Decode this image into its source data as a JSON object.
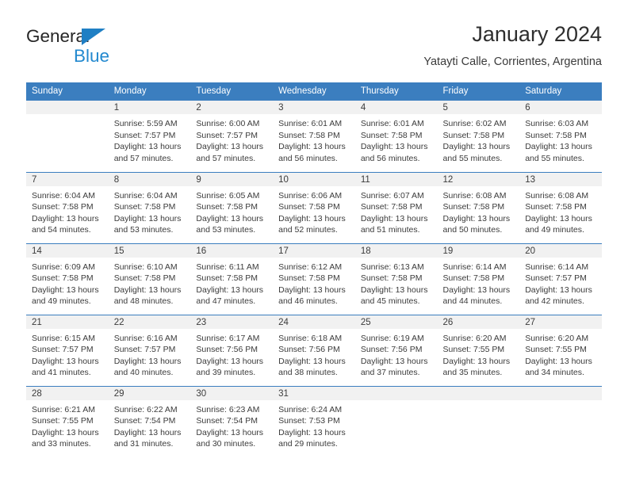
{
  "brand": {
    "name_top": "General",
    "name_bottom": "Blue",
    "color_dark": "#262626",
    "color_blue": "#2389cf"
  },
  "header": {
    "title": "January 2024",
    "subtitle": "Yatayti Calle, Corrientes, Argentina"
  },
  "theme": {
    "header_blue": "#3b7ebf",
    "daynum_band": "#f1f1f1",
    "text": "#3b3b3b"
  },
  "weekdays": [
    "Sunday",
    "Monday",
    "Tuesday",
    "Wednesday",
    "Thursday",
    "Friday",
    "Saturday"
  ],
  "weeks": [
    [
      {
        "day": "",
        "lines": []
      },
      {
        "day": "1",
        "lines": [
          "Sunrise: 5:59 AM",
          "Sunset: 7:57 PM",
          "Daylight: 13 hours",
          "and 57 minutes."
        ]
      },
      {
        "day": "2",
        "lines": [
          "Sunrise: 6:00 AM",
          "Sunset: 7:57 PM",
          "Daylight: 13 hours",
          "and 57 minutes."
        ]
      },
      {
        "day": "3",
        "lines": [
          "Sunrise: 6:01 AM",
          "Sunset: 7:58 PM",
          "Daylight: 13 hours",
          "and 56 minutes."
        ]
      },
      {
        "day": "4",
        "lines": [
          "Sunrise: 6:01 AM",
          "Sunset: 7:58 PM",
          "Daylight: 13 hours",
          "and 56 minutes."
        ]
      },
      {
        "day": "5",
        "lines": [
          "Sunrise: 6:02 AM",
          "Sunset: 7:58 PM",
          "Daylight: 13 hours",
          "and 55 minutes."
        ]
      },
      {
        "day": "6",
        "lines": [
          "Sunrise: 6:03 AM",
          "Sunset: 7:58 PM",
          "Daylight: 13 hours",
          "and 55 minutes."
        ]
      }
    ],
    [
      {
        "day": "7",
        "lines": [
          "Sunrise: 6:04 AM",
          "Sunset: 7:58 PM",
          "Daylight: 13 hours",
          "and 54 minutes."
        ]
      },
      {
        "day": "8",
        "lines": [
          "Sunrise: 6:04 AM",
          "Sunset: 7:58 PM",
          "Daylight: 13 hours",
          "and 53 minutes."
        ]
      },
      {
        "day": "9",
        "lines": [
          "Sunrise: 6:05 AM",
          "Sunset: 7:58 PM",
          "Daylight: 13 hours",
          "and 53 minutes."
        ]
      },
      {
        "day": "10",
        "lines": [
          "Sunrise: 6:06 AM",
          "Sunset: 7:58 PM",
          "Daylight: 13 hours",
          "and 52 minutes."
        ]
      },
      {
        "day": "11",
        "lines": [
          "Sunrise: 6:07 AM",
          "Sunset: 7:58 PM",
          "Daylight: 13 hours",
          "and 51 minutes."
        ]
      },
      {
        "day": "12",
        "lines": [
          "Sunrise: 6:08 AM",
          "Sunset: 7:58 PM",
          "Daylight: 13 hours",
          "and 50 minutes."
        ]
      },
      {
        "day": "13",
        "lines": [
          "Sunrise: 6:08 AM",
          "Sunset: 7:58 PM",
          "Daylight: 13 hours",
          "and 49 minutes."
        ]
      }
    ],
    [
      {
        "day": "14",
        "lines": [
          "Sunrise: 6:09 AM",
          "Sunset: 7:58 PM",
          "Daylight: 13 hours",
          "and 49 minutes."
        ]
      },
      {
        "day": "15",
        "lines": [
          "Sunrise: 6:10 AM",
          "Sunset: 7:58 PM",
          "Daylight: 13 hours",
          "and 48 minutes."
        ]
      },
      {
        "day": "16",
        "lines": [
          "Sunrise: 6:11 AM",
          "Sunset: 7:58 PM",
          "Daylight: 13 hours",
          "and 47 minutes."
        ]
      },
      {
        "day": "17",
        "lines": [
          "Sunrise: 6:12 AM",
          "Sunset: 7:58 PM",
          "Daylight: 13 hours",
          "and 46 minutes."
        ]
      },
      {
        "day": "18",
        "lines": [
          "Sunrise: 6:13 AM",
          "Sunset: 7:58 PM",
          "Daylight: 13 hours",
          "and 45 minutes."
        ]
      },
      {
        "day": "19",
        "lines": [
          "Sunrise: 6:14 AM",
          "Sunset: 7:58 PM",
          "Daylight: 13 hours",
          "and 44 minutes."
        ]
      },
      {
        "day": "20",
        "lines": [
          "Sunrise: 6:14 AM",
          "Sunset: 7:57 PM",
          "Daylight: 13 hours",
          "and 42 minutes."
        ]
      }
    ],
    [
      {
        "day": "21",
        "lines": [
          "Sunrise: 6:15 AM",
          "Sunset: 7:57 PM",
          "Daylight: 13 hours",
          "and 41 minutes."
        ]
      },
      {
        "day": "22",
        "lines": [
          "Sunrise: 6:16 AM",
          "Sunset: 7:57 PM",
          "Daylight: 13 hours",
          "and 40 minutes."
        ]
      },
      {
        "day": "23",
        "lines": [
          "Sunrise: 6:17 AM",
          "Sunset: 7:56 PM",
          "Daylight: 13 hours",
          "and 39 minutes."
        ]
      },
      {
        "day": "24",
        "lines": [
          "Sunrise: 6:18 AM",
          "Sunset: 7:56 PM",
          "Daylight: 13 hours",
          "and 38 minutes."
        ]
      },
      {
        "day": "25",
        "lines": [
          "Sunrise: 6:19 AM",
          "Sunset: 7:56 PM",
          "Daylight: 13 hours",
          "and 37 minutes."
        ]
      },
      {
        "day": "26",
        "lines": [
          "Sunrise: 6:20 AM",
          "Sunset: 7:55 PM",
          "Daylight: 13 hours",
          "and 35 minutes."
        ]
      },
      {
        "day": "27",
        "lines": [
          "Sunrise: 6:20 AM",
          "Sunset: 7:55 PM",
          "Daylight: 13 hours",
          "and 34 minutes."
        ]
      }
    ],
    [
      {
        "day": "28",
        "lines": [
          "Sunrise: 6:21 AM",
          "Sunset: 7:55 PM",
          "Daylight: 13 hours",
          "and 33 minutes."
        ]
      },
      {
        "day": "29",
        "lines": [
          "Sunrise: 6:22 AM",
          "Sunset: 7:54 PM",
          "Daylight: 13 hours",
          "and 31 minutes."
        ]
      },
      {
        "day": "30",
        "lines": [
          "Sunrise: 6:23 AM",
          "Sunset: 7:54 PM",
          "Daylight: 13 hours",
          "and 30 minutes."
        ]
      },
      {
        "day": "31",
        "lines": [
          "Sunrise: 6:24 AM",
          "Sunset: 7:53 PM",
          "Daylight: 13 hours",
          "and 29 minutes."
        ]
      },
      {
        "day": "",
        "lines": []
      },
      {
        "day": "",
        "lines": []
      },
      {
        "day": "",
        "lines": []
      }
    ]
  ]
}
